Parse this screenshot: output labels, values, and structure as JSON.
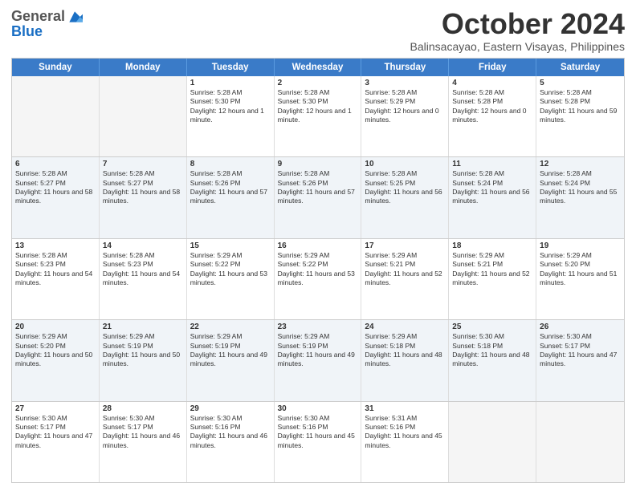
{
  "logo": {
    "general": "General",
    "blue": "Blue"
  },
  "header": {
    "month": "October 2024",
    "subtitle": "Balinsacayao, Eastern Visayas, Philippines"
  },
  "days": [
    "Sunday",
    "Monday",
    "Tuesday",
    "Wednesday",
    "Thursday",
    "Friday",
    "Saturday"
  ],
  "rows": [
    [
      {
        "day": "",
        "empty": true
      },
      {
        "day": "",
        "empty": true
      },
      {
        "day": "1",
        "sunrise": "Sunrise: 5:28 AM",
        "sunset": "Sunset: 5:30 PM",
        "daylight": "Daylight: 12 hours and 1 minute."
      },
      {
        "day": "2",
        "sunrise": "Sunrise: 5:28 AM",
        "sunset": "Sunset: 5:30 PM",
        "daylight": "Daylight: 12 hours and 1 minute."
      },
      {
        "day": "3",
        "sunrise": "Sunrise: 5:28 AM",
        "sunset": "Sunset: 5:29 PM",
        "daylight": "Daylight: 12 hours and 0 minutes."
      },
      {
        "day": "4",
        "sunrise": "Sunrise: 5:28 AM",
        "sunset": "Sunset: 5:28 PM",
        "daylight": "Daylight: 12 hours and 0 minutes."
      },
      {
        "day": "5",
        "sunrise": "Sunrise: 5:28 AM",
        "sunset": "Sunset: 5:28 PM",
        "daylight": "Daylight: 11 hours and 59 minutes."
      }
    ],
    [
      {
        "day": "6",
        "sunrise": "Sunrise: 5:28 AM",
        "sunset": "Sunset: 5:27 PM",
        "daylight": "Daylight: 11 hours and 58 minutes."
      },
      {
        "day": "7",
        "sunrise": "Sunrise: 5:28 AM",
        "sunset": "Sunset: 5:27 PM",
        "daylight": "Daylight: 11 hours and 58 minutes."
      },
      {
        "day": "8",
        "sunrise": "Sunrise: 5:28 AM",
        "sunset": "Sunset: 5:26 PM",
        "daylight": "Daylight: 11 hours and 57 minutes."
      },
      {
        "day": "9",
        "sunrise": "Sunrise: 5:28 AM",
        "sunset": "Sunset: 5:26 PM",
        "daylight": "Daylight: 11 hours and 57 minutes."
      },
      {
        "day": "10",
        "sunrise": "Sunrise: 5:28 AM",
        "sunset": "Sunset: 5:25 PM",
        "daylight": "Daylight: 11 hours and 56 minutes."
      },
      {
        "day": "11",
        "sunrise": "Sunrise: 5:28 AM",
        "sunset": "Sunset: 5:24 PM",
        "daylight": "Daylight: 11 hours and 56 minutes."
      },
      {
        "day": "12",
        "sunrise": "Sunrise: 5:28 AM",
        "sunset": "Sunset: 5:24 PM",
        "daylight": "Daylight: 11 hours and 55 minutes."
      }
    ],
    [
      {
        "day": "13",
        "sunrise": "Sunrise: 5:28 AM",
        "sunset": "Sunset: 5:23 PM",
        "daylight": "Daylight: 11 hours and 54 minutes."
      },
      {
        "day": "14",
        "sunrise": "Sunrise: 5:28 AM",
        "sunset": "Sunset: 5:23 PM",
        "daylight": "Daylight: 11 hours and 54 minutes."
      },
      {
        "day": "15",
        "sunrise": "Sunrise: 5:29 AM",
        "sunset": "Sunset: 5:22 PM",
        "daylight": "Daylight: 11 hours and 53 minutes."
      },
      {
        "day": "16",
        "sunrise": "Sunrise: 5:29 AM",
        "sunset": "Sunset: 5:22 PM",
        "daylight": "Daylight: 11 hours and 53 minutes."
      },
      {
        "day": "17",
        "sunrise": "Sunrise: 5:29 AM",
        "sunset": "Sunset: 5:21 PM",
        "daylight": "Daylight: 11 hours and 52 minutes."
      },
      {
        "day": "18",
        "sunrise": "Sunrise: 5:29 AM",
        "sunset": "Sunset: 5:21 PM",
        "daylight": "Daylight: 11 hours and 52 minutes."
      },
      {
        "day": "19",
        "sunrise": "Sunrise: 5:29 AM",
        "sunset": "Sunset: 5:20 PM",
        "daylight": "Daylight: 11 hours and 51 minutes."
      }
    ],
    [
      {
        "day": "20",
        "sunrise": "Sunrise: 5:29 AM",
        "sunset": "Sunset: 5:20 PM",
        "daylight": "Daylight: 11 hours and 50 minutes."
      },
      {
        "day": "21",
        "sunrise": "Sunrise: 5:29 AM",
        "sunset": "Sunset: 5:19 PM",
        "daylight": "Daylight: 11 hours and 50 minutes."
      },
      {
        "day": "22",
        "sunrise": "Sunrise: 5:29 AM",
        "sunset": "Sunset: 5:19 PM",
        "daylight": "Daylight: 11 hours and 49 minutes."
      },
      {
        "day": "23",
        "sunrise": "Sunrise: 5:29 AM",
        "sunset": "Sunset: 5:19 PM",
        "daylight": "Daylight: 11 hours and 49 minutes."
      },
      {
        "day": "24",
        "sunrise": "Sunrise: 5:29 AM",
        "sunset": "Sunset: 5:18 PM",
        "daylight": "Daylight: 11 hours and 48 minutes."
      },
      {
        "day": "25",
        "sunrise": "Sunrise: 5:30 AM",
        "sunset": "Sunset: 5:18 PM",
        "daylight": "Daylight: 11 hours and 48 minutes."
      },
      {
        "day": "26",
        "sunrise": "Sunrise: 5:30 AM",
        "sunset": "Sunset: 5:17 PM",
        "daylight": "Daylight: 11 hours and 47 minutes."
      }
    ],
    [
      {
        "day": "27",
        "sunrise": "Sunrise: 5:30 AM",
        "sunset": "Sunset: 5:17 PM",
        "daylight": "Daylight: 11 hours and 47 minutes."
      },
      {
        "day": "28",
        "sunrise": "Sunrise: 5:30 AM",
        "sunset": "Sunset: 5:17 PM",
        "daylight": "Daylight: 11 hours and 46 minutes."
      },
      {
        "day": "29",
        "sunrise": "Sunrise: 5:30 AM",
        "sunset": "Sunset: 5:16 PM",
        "daylight": "Daylight: 11 hours and 46 minutes."
      },
      {
        "day": "30",
        "sunrise": "Sunrise: 5:30 AM",
        "sunset": "Sunset: 5:16 PM",
        "daylight": "Daylight: 11 hours and 45 minutes."
      },
      {
        "day": "31",
        "sunrise": "Sunrise: 5:31 AM",
        "sunset": "Sunset: 5:16 PM",
        "daylight": "Daylight: 11 hours and 45 minutes."
      },
      {
        "day": "",
        "empty": true
      },
      {
        "day": "",
        "empty": true
      }
    ]
  ]
}
